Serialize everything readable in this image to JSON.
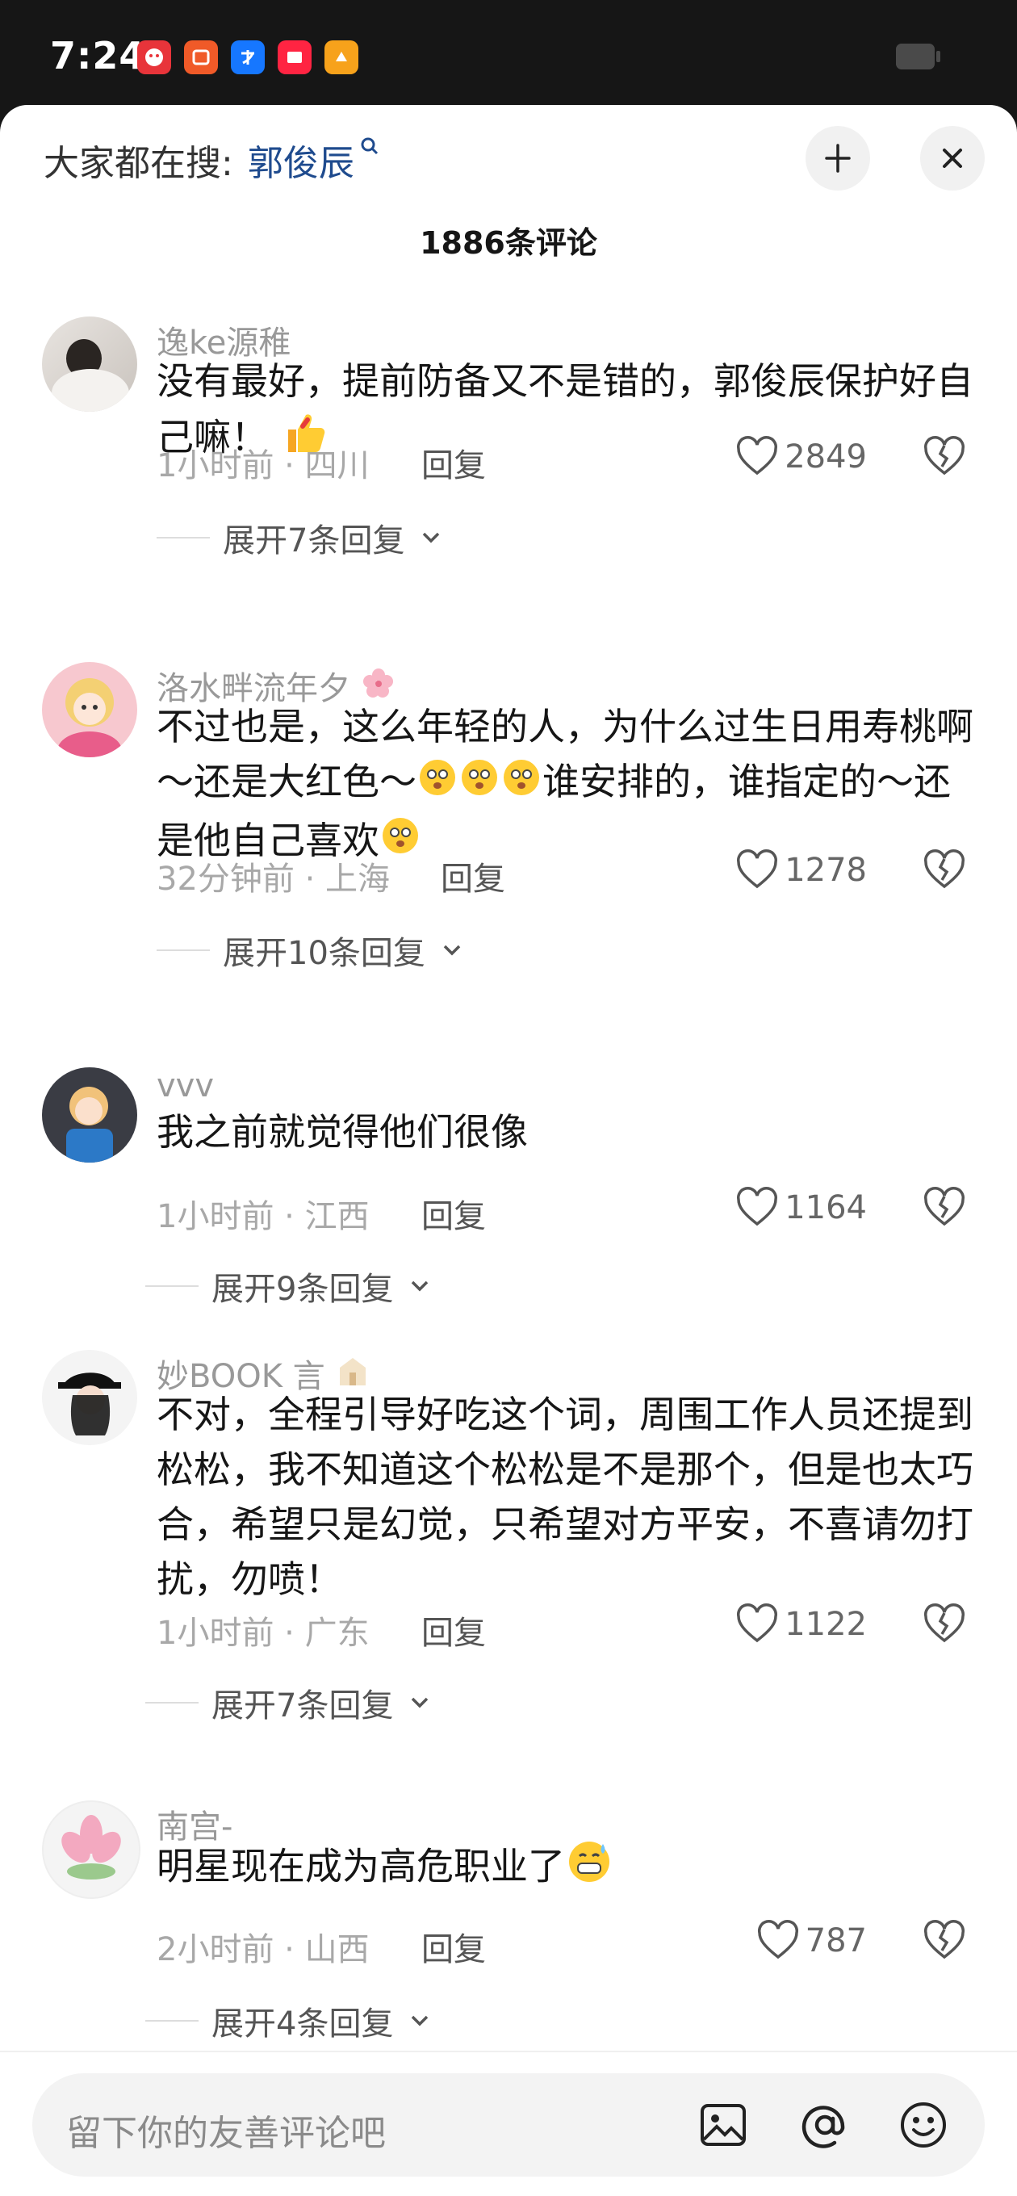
{
  "status_bar": {
    "time": "7:24",
    "notification_apps": [
      {
        "icon": "app-red-icon",
        "glyph": "☻",
        "color": "#e8343a"
      },
      {
        "icon": "taobao-icon",
        "glyph": "淘",
        "color": "#f05a28"
      },
      {
        "icon": "alipay-icon",
        "glyph": "支",
        "color": "#1677ff"
      },
      {
        "icon": "xiaohongshu-icon",
        "glyph": "▣",
        "color": "#ff2442"
      },
      {
        "icon": "app-yellow-icon",
        "glyph": "✦",
        "color": "#f7a21b"
      }
    ]
  },
  "header": {
    "search_hint_label": "大家都在搜:",
    "search_keyword": "郭俊辰",
    "comment_count": "1886条评论",
    "keyword_color": "#1f4b8e"
  },
  "comments": [
    {
      "username": "逸ke源稚",
      "text": "没有最好，提前防备又不是错的，郭俊辰保护好自己嘛！",
      "time_location": "1小时前 · 四川",
      "reply_label": "回复",
      "likes": "2849",
      "expand_label": "展开7条回复"
    },
    {
      "username": "洛水畔流年夕",
      "text_part1": "不过也是，这么年轻的人，为什么过生日用寿桃啊～还是大红色～",
      "text_part2": "谁安排的，谁指定的～还是他自己喜欢",
      "time_location": "32分钟前 · 上海",
      "reply_label": "回复",
      "likes": "1278",
      "expand_label": "展开10条回复"
    },
    {
      "username": "vvv",
      "text": "我之前就觉得他们很像",
      "time_location": "1小时前 · 江西",
      "reply_label": "回复",
      "likes": "1164",
      "expand_label": "展开9条回复"
    },
    {
      "username": "妙BOOK 言",
      "text": "不对，全程引导好吃这个词，周围工作人员还提到松松，我不知道这个松松是不是那个，但是也太巧合，希望只是幻觉，只希望对方平安，不喜请勿打扰，勿喷！",
      "time_location": "1小时前 · 广东",
      "reply_label": "回复",
      "likes": "1122",
      "expand_label": "展开7条回复"
    },
    {
      "username": "南宫-",
      "text": "明星现在成为高危职业了",
      "time_location": "2小时前 · 山西",
      "reply_label": "回复",
      "likes": "787",
      "expand_label": "展开4条回复"
    }
  ],
  "input": {
    "placeholder": "留下你的友善评论吧"
  }
}
